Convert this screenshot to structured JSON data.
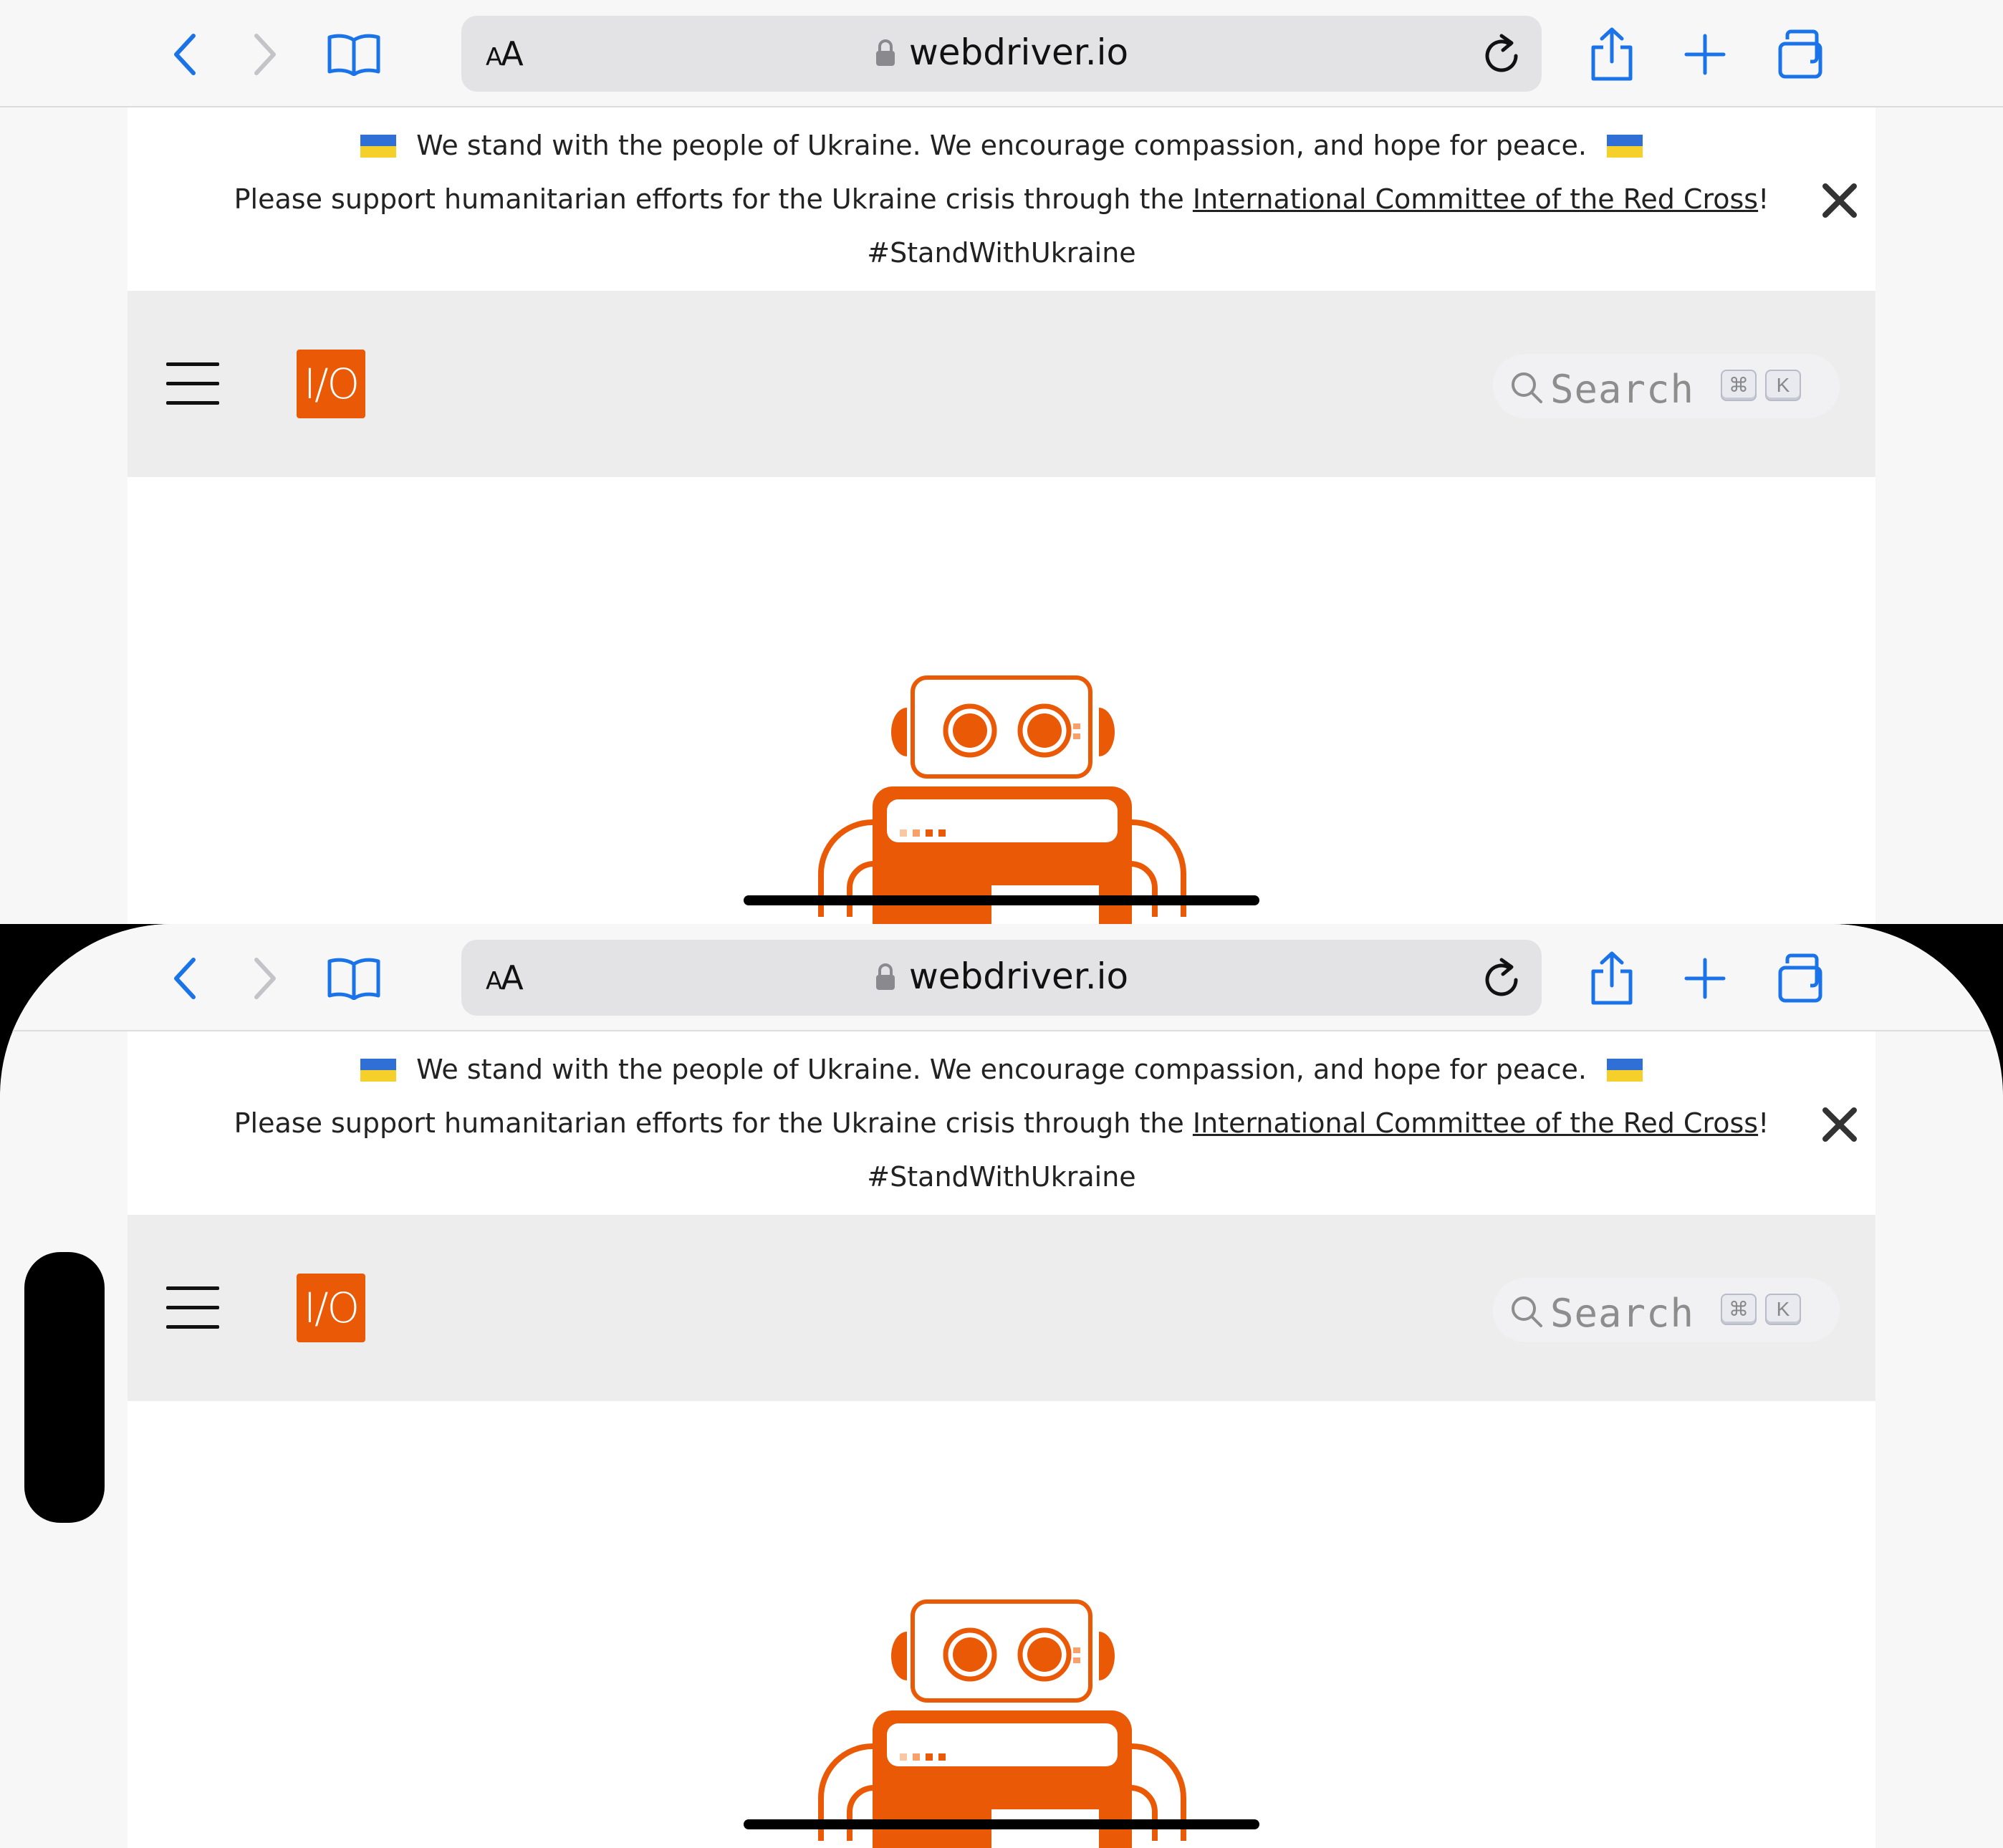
{
  "browser": {
    "reader_label": "AA",
    "url": "webdriver.io",
    "back_icon": "chevron-left-icon",
    "forward_icon": "chevron-right-icon",
    "bookmarks_icon": "book-icon",
    "share_icon": "share-icon",
    "new_tab_icon": "plus-icon",
    "tabs_icon": "tabs-overview-icon",
    "reload_icon": "reload-icon",
    "accent_color": "#1a73e8"
  },
  "banner": {
    "line1": "We stand with the people of Ukraine. We encourage compassion, and hope for peace.",
    "line2_prefix": "Please support humanitarian efforts for the Ukraine crisis through the ",
    "link_text": "International Committee of the Red Cross",
    "line2_suffix": "!",
    "hashtag": "#StandWithUkraine",
    "flag_colors": [
      "#2f6fd6",
      "#f5d02a"
    ]
  },
  "navbar": {
    "logo_text": "I/O",
    "logo_color": "#ea5906",
    "search_placeholder": "Search",
    "shortcut_keys": [
      "⌘",
      "K"
    ]
  },
  "hero": {
    "robot_color": "#ea5906"
  }
}
